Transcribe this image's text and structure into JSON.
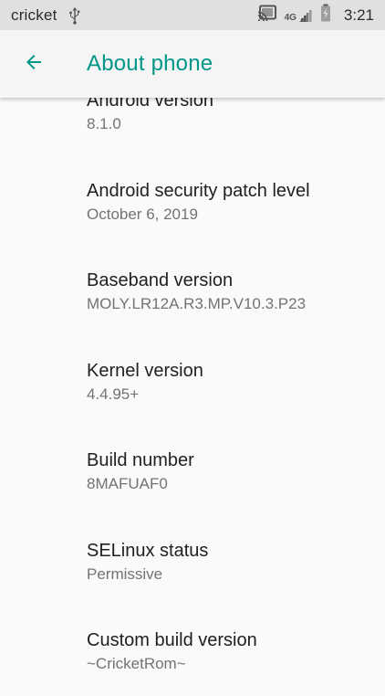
{
  "status_bar": {
    "carrier": "cricket",
    "network_badge": "4G",
    "time": "3:21",
    "icons": [
      "usb-icon",
      "cast-icon",
      "signal-icon",
      "battery-charging-icon"
    ]
  },
  "app_bar": {
    "title": "About phone",
    "back_icon": "arrow-back-icon",
    "accent": "#009688"
  },
  "items": [
    {
      "title": "Android version",
      "summary": "8.1.0"
    },
    {
      "title": "Android security patch level",
      "summary": "October 6, 2019"
    },
    {
      "title": "Baseband version",
      "summary": "MOLY.LR12A.R3.MP.V10.3.P23"
    },
    {
      "title": "Kernel version",
      "summary": "4.4.95+"
    },
    {
      "title": "Build number",
      "summary": "8MAFUAF0"
    },
    {
      "title": "SELinux status",
      "summary": "Permissive"
    },
    {
      "title": "Custom build version",
      "summary": "~CricketRom~"
    }
  ]
}
